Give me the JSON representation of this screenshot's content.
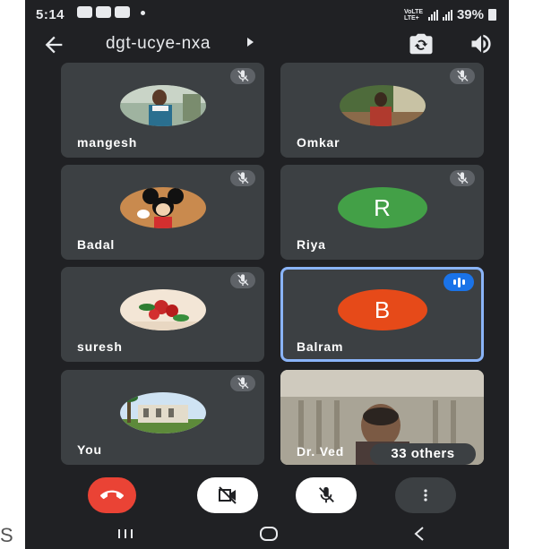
{
  "status_bar": {
    "time": "5:14",
    "network_label": "VoLTE LTE+",
    "battery": "39%"
  },
  "header": {
    "meeting_code": "dgt-ucye-nxa"
  },
  "participants": [
    {
      "name": "mangesh"
    },
    {
      "name": "Omkar"
    },
    {
      "name": "Badal"
    },
    {
      "name": "Riya",
      "initial": "R",
      "avatar_color": "#43a047"
    },
    {
      "name": "suresh"
    },
    {
      "name": "Balram",
      "initial": "B",
      "avatar_color": "#e64a19",
      "speaking": true
    },
    {
      "name": "You"
    },
    {
      "name": "Dr. Ved"
    }
  ],
  "others_label": "33 others",
  "controls": [
    "end-call",
    "camera-off",
    "mic-off",
    "more-options"
  ],
  "colors": {
    "background": "#202124",
    "tile": "#3c4043",
    "end_call": "#ea4335",
    "speaking": "#1a73e8",
    "active_border": "#8ab4f8"
  },
  "stray_text": "S"
}
